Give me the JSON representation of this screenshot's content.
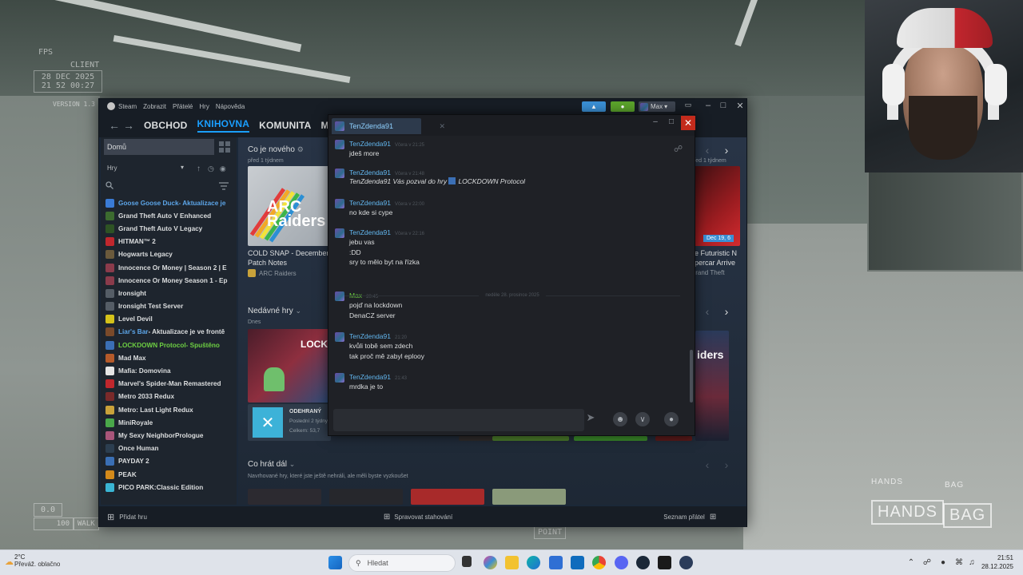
{
  "hud": {
    "fps_label": "FPS",
    "client_label": "CLIENT",
    "date": "28 DEC 2025",
    "time": "21 52 00:27",
    "version": "VERSION 1.3",
    "counter_top": "0.0",
    "counter_bottom": "100",
    "walk": "WALK",
    "point": "POINT",
    "hands_small": "HANDS",
    "bag_small": "BAG",
    "hands": "HANDS",
    "bag": "BAG"
  },
  "steam": {
    "menu": [
      "Steam",
      "Zobrazit",
      "Přátelé",
      "Hry",
      "Nápověda"
    ],
    "user_name": "Max",
    "nav": [
      "OBCHOD",
      "KNIHOVNA",
      "KOMUNITA",
      "MAX"
    ],
    "sidebar": {
      "home": "Domů",
      "filter": "Hry",
      "games": [
        {
          "name": "Goose Goose Duck",
          "suffix": " - Aktualizace je",
          "color": "#3a7bd5",
          "name_color": "#5ca5e8",
          "suffix_color": "#5ca5e8"
        },
        {
          "name": "Grand Theft Auto V Enhanced",
          "suffix": "",
          "color": "#3c6b2f"
        },
        {
          "name": "Grand Theft Auto V Legacy",
          "suffix": "",
          "color": "#2e5324"
        },
        {
          "name": "HITMAN™ 2",
          "suffix": "",
          "color": "#c0272d"
        },
        {
          "name": "Hogwarts Legacy",
          "suffix": "",
          "color": "#6b5a3c"
        },
        {
          "name": "Innocence Or Money | Season 2 | E",
          "suffix": "",
          "color": "#8a3b4b"
        },
        {
          "name": "Innocence Or Money Season 1 - Ep",
          "suffix": "",
          "color": "#8a3b4b"
        },
        {
          "name": "Ironsight",
          "suffix": "",
          "color": "#555d66"
        },
        {
          "name": "Ironsight Test Server",
          "suffix": "",
          "color": "#555d66"
        },
        {
          "name": "Level Devil",
          "suffix": "",
          "color": "#d4c21a"
        },
        {
          "name": "Liar's Bar",
          "suffix": " - Aktualizace je ve frontě",
          "color": "#7a4a2a",
          "name_color": "#5ca5e8",
          "suffix_color": "#dcdedf"
        },
        {
          "name": "LOCKDOWN Protocol",
          "suffix": " - Spuštěno",
          "color": "#3b6fb5",
          "name_color": "#6dcf42",
          "suffix_color": "#6dcf42"
        },
        {
          "name": "Mad Max",
          "suffix": "",
          "color": "#b55a2a"
        },
        {
          "name": "Mafia: Domovina",
          "suffix": "",
          "color": "#e5e5e5"
        },
        {
          "name": "Marvel's Spider-Man Remastered",
          "suffix": "",
          "color": "#c0272d"
        },
        {
          "name": "Metro 2033 Redux",
          "suffix": "",
          "color": "#7a2a2a"
        },
        {
          "name": "Metro: Last Light Redux",
          "suffix": "",
          "color": "#c9a23a"
        },
        {
          "name": "MiniRoyale",
          "suffix": "",
          "color": "#4aa84a"
        },
        {
          "name": "My Sexy Neighbor",
          "suffix": "  Prologue",
          "color": "#a8557a",
          "suffix_color": "#dcdedf"
        },
        {
          "name": "Once Human",
          "suffix": "",
          "color": "#2c3e50"
        },
        {
          "name": "PAYDAY 2",
          "suffix": "",
          "color": "#3a6fb5"
        },
        {
          "name": "PEAK",
          "suffix": "",
          "color": "#d48a1a"
        },
        {
          "name": "PICO PARK:Classic Edition",
          "suffix": "",
          "color": "#3ab5d4"
        }
      ]
    },
    "content": {
      "whats_new": "Co je nového",
      "whats_new_sub": "před 1 týdnem",
      "news_right_sub": "před 1 týdnem",
      "news_card_title_1": "COLD SNAP - December",
      "news_card_title_2": "Patch Notes",
      "news_card_game": "ARC Raiders",
      "arc_logo_1": "ARC",
      "arc_logo_2": "Raiders",
      "news_right_title_1": "he Futuristic N",
      "news_right_title_2": "upercar Arrive",
      "news_right_game": "Grand Theft",
      "news_right_date": "Dec 19, 6",
      "recent_games": "Nedávné hry",
      "recent_sub": "Dnes",
      "played_label": "ODEHRANÝ",
      "last_played": "Poslední 2 týdny",
      "total_played": "Celkem: 53,7",
      "lockdown_logo": "LOCKD",
      "raiders_logo": "iders",
      "play_next": "Co hrát dál",
      "play_next_sub": "Navrhované hry, které jste ještě nehráli, ale měli byste vyzkoušet"
    },
    "bottom": {
      "add_game": "Přidat hru",
      "downloads": "Spravovat stahování",
      "friends": "Seznam přátel"
    }
  },
  "chat": {
    "tab_name": "TenZdenda91",
    "date_separator": "neděle 28. prosince 2025",
    "input_placeholder": "",
    "messages": [
      {
        "name": "TenZdenda91",
        "time": "Včera v 21:25",
        "self": false,
        "lines": [
          "jdeš more"
        ]
      },
      {
        "name": "TenZdenda91",
        "time": "Včera v 21:48",
        "self": false,
        "invite_sender": "TenZdenda91",
        "invite_text": " Vás pozval do hry ",
        "invite_game": "LOCKDOWN Protocol",
        "lines": []
      },
      {
        "name": "TenZdenda91",
        "time": "Včera v 22:00",
        "self": false,
        "lines": [
          "no kde si cype"
        ]
      },
      {
        "name": "TenZdenda91",
        "time": "Včera v 22:16",
        "self": false,
        "lines": [
          "jebu vas",
          ":DD",
          "sry to mělo byt na řízka"
        ]
      },
      {
        "name": "Max",
        "time": "20:45",
        "self": true,
        "lines": [
          "pojď na lockdown",
          "DenaCZ server"
        ]
      },
      {
        "name": "TenZdenda91",
        "time": "21:20",
        "self": false,
        "lines": [
          "kvůli tobě sem zdech",
          "tak proč mě zabyl eplooy"
        ]
      },
      {
        "name": "TenZdenda91",
        "time": "21:43",
        "self": false,
        "lines": [
          "mrdka je to"
        ]
      }
    ]
  },
  "taskbar": {
    "temperature": "2°C",
    "weather": "Převáž. oblačno",
    "search": "Hledat",
    "time": "21:51",
    "date": "28.12.2025"
  },
  "colors": {
    "steam_blue": "#1a9fff",
    "friend_blue": "#62b6ee",
    "ingame_green": "#6dcf42",
    "close_red": "#c42b1c"
  }
}
